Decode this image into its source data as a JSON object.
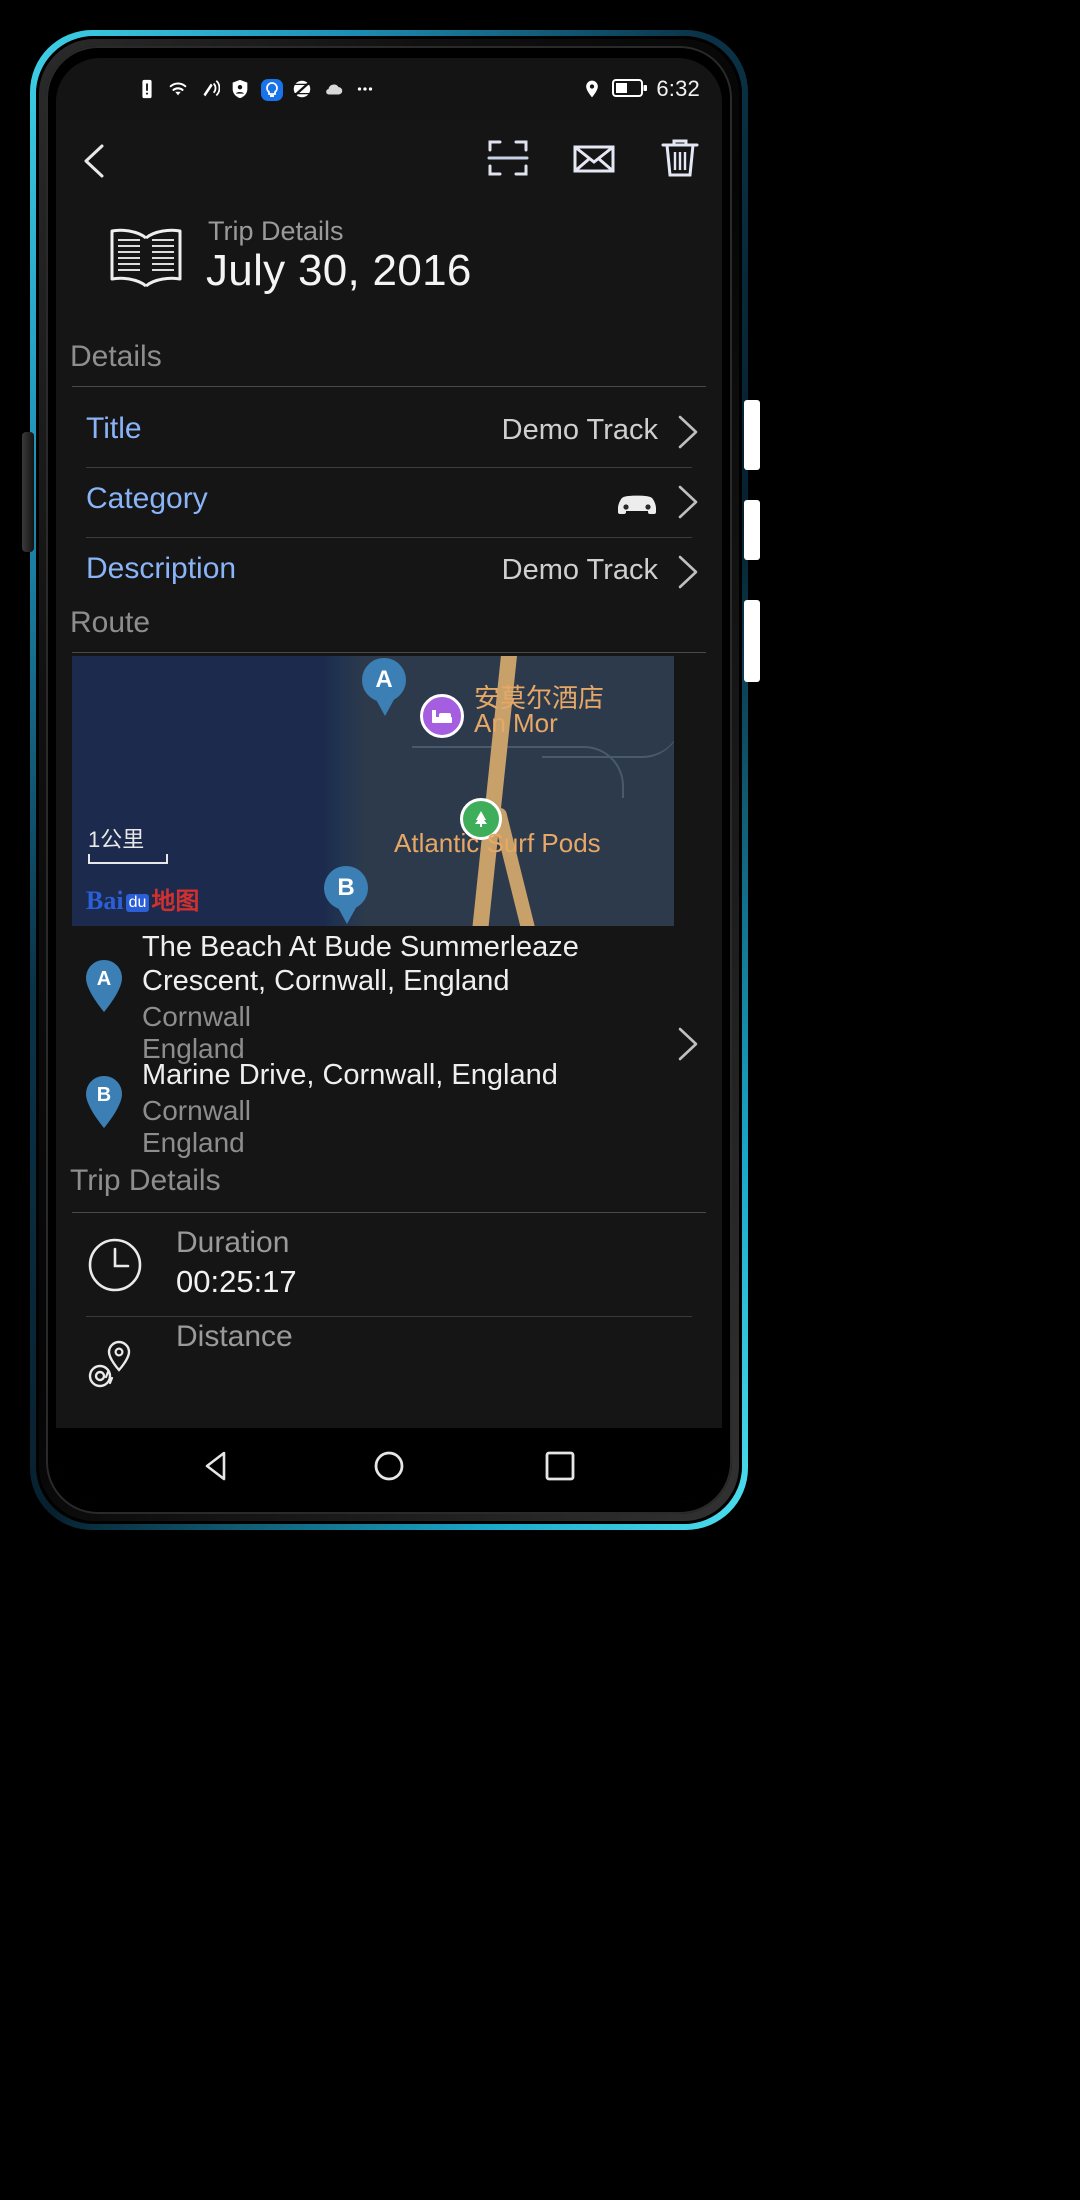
{
  "status_bar": {
    "time": "6:32",
    "left_icons": [
      "sim-alert-icon",
      "wifi-icon",
      "vibrate-icon",
      "shield-person-icon",
      "bulb-icon",
      "globe-slash-icon",
      "cloud-icon",
      "more-icon"
    ],
    "right_icons": [
      "location-icon",
      "battery-icon"
    ]
  },
  "app_bar": {
    "back": "back-arrow",
    "actions": [
      {
        "name": "scan-icon",
        "label": "Scan"
      },
      {
        "name": "mail-icon",
        "label": "Mail"
      },
      {
        "name": "trash-icon",
        "label": "Delete"
      }
    ]
  },
  "header": {
    "icon": "book-icon",
    "subtitle": "Trip Details",
    "title": "July 30, 2016"
  },
  "sections": {
    "details_label": "Details",
    "route_label": "Route",
    "trip_details_label": "Trip Details"
  },
  "details_rows": [
    {
      "key": "Title",
      "value": "Demo Track",
      "icon": null
    },
    {
      "key": "Category",
      "value": "",
      "icon": "car-icon"
    },
    {
      "key": "Description",
      "value": "Demo Track",
      "icon": null
    }
  ],
  "map": {
    "scale_label": "1公里",
    "attribution_parts": {
      "brand": "Bai",
      "badge": "du",
      "chinese": "地图"
    },
    "markers": [
      {
        "label": "A",
        "type": "route-start"
      },
      {
        "label": "B",
        "type": "route-end"
      }
    ],
    "pois": [
      {
        "name_cn": "安莫尔酒店",
        "name_en": "An Mor",
        "icon": "hotel-icon",
        "color": "#a55ee0"
      },
      {
        "name_en": "Atlantic Surf Pods",
        "icon": "campsite-icon",
        "color": "#3fae5a"
      }
    ],
    "colors": {
      "sea": "#1c2b4d",
      "land": "#2c3a4b",
      "road": "#c8a06a",
      "label": "#e6a767"
    }
  },
  "route_items": [
    {
      "marker": "A",
      "primary": "The Beach At Bude Summerleaze Crescent, Cornwall, England",
      "secondary_1": "Cornwall",
      "secondary_2": "England"
    },
    {
      "marker": "B",
      "primary": "Marine Drive, Cornwall, England",
      "secondary_1": "Cornwall",
      "secondary_2": "England"
    }
  ],
  "trip_details_rows": [
    {
      "icon": "clock-icon",
      "label": "Duration",
      "value": "00:25:17"
    },
    {
      "icon": "distance-pin-icon",
      "label": "Distance",
      "value": ""
    }
  ],
  "nav_bar": {
    "back": "triangle-back-icon",
    "home": "circle-home-icon",
    "recents": "square-recents-icon"
  },
  "theme": {
    "background": "#151515",
    "accent_blue": "#8ab4f8",
    "text_primary": "#f2f2f2",
    "text_secondary": "#8e8e8e"
  }
}
